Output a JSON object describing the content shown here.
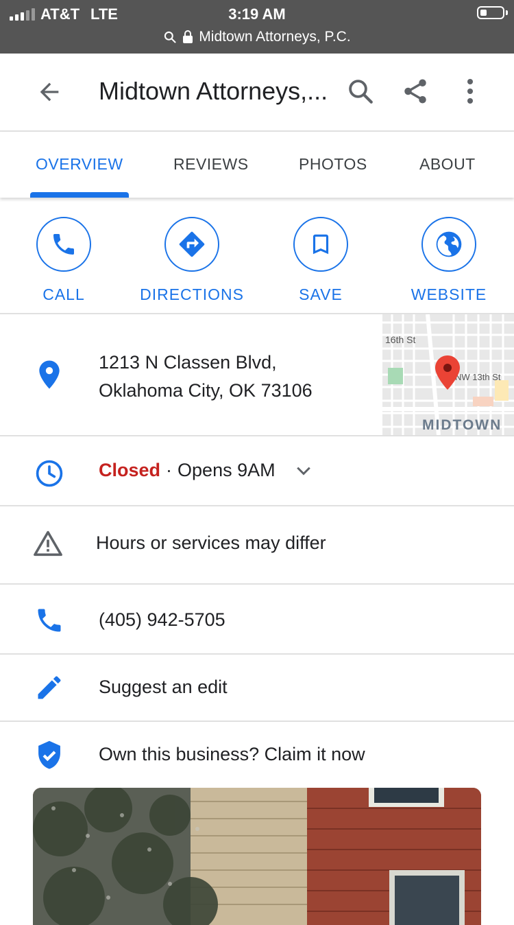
{
  "status_bar": {
    "carrier": "AT&T",
    "network": "LTE",
    "time": "3:19 AM",
    "url": "Midtown Attorneys, P.C."
  },
  "app_bar": {
    "title": "Midtown Attorneys,..."
  },
  "tabs": [
    {
      "label": "OVERVIEW",
      "active": true
    },
    {
      "label": "REVIEWS",
      "active": false
    },
    {
      "label": "PHOTOS",
      "active": false
    },
    {
      "label": "ABOUT",
      "active": false
    }
  ],
  "actions": [
    {
      "label": "CALL",
      "icon": "phone-icon"
    },
    {
      "label": "DIRECTIONS",
      "icon": "directions-icon"
    },
    {
      "label": "SAVE",
      "icon": "bookmark-icon"
    },
    {
      "label": "WEBSITE",
      "icon": "globe-icon"
    }
  ],
  "address": {
    "line1": "1213 N Classen Blvd,",
    "line2": "Oklahoma City, OK 73106"
  },
  "map": {
    "street1": "16th St",
    "street2": "NW 13th St",
    "area": "MIDTOWN"
  },
  "hours": {
    "status": "Closed",
    "separator": "·",
    "opens": "Opens 9AM"
  },
  "notice": "Hours or services may differ",
  "phone": "(405) 942-5705",
  "suggest_edit": "Suggest an edit",
  "claim": "Own this business? Claim it now",
  "colors": {
    "accent": "#1a73e8",
    "closed": "#c5221f",
    "status_bar": "#555555"
  }
}
